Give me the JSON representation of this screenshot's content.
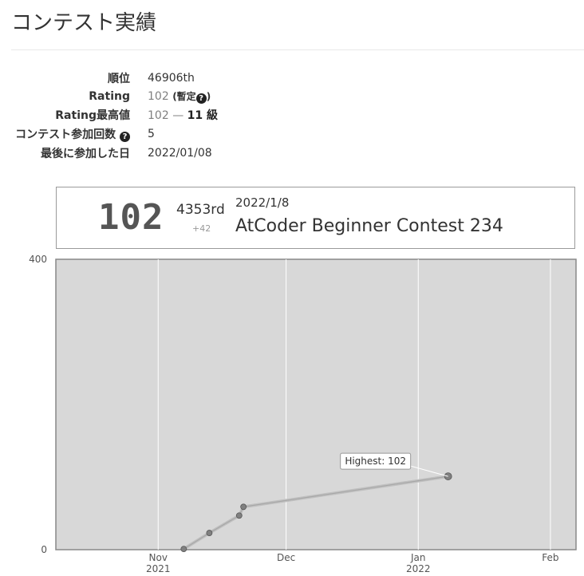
{
  "page": {
    "title": "コンテスト実績"
  },
  "stats": {
    "rank_label": "順位",
    "rank_value": "46906th",
    "rating_label": "Rating",
    "rating_value": "102",
    "rating_note_prefix": "(",
    "rating_note": "暫定",
    "rating_note_suffix": ")",
    "highest_label": "Rating最高値",
    "highest_value": "102",
    "highest_sep": "—",
    "highest_kyu": "11 級",
    "participation_label": "コンテスト参加回数",
    "participation_value": "5",
    "last_label": "最後に参加した日",
    "last_value": "2022/01/08"
  },
  "card": {
    "rating": "102",
    "rank": "4353rd",
    "diff": "+42",
    "date": "2022/1/8",
    "contest": "AtCoder Beginner Contest 234"
  },
  "chart_data": {
    "type": "line",
    "y_ticks": [
      "0",
      "400"
    ],
    "ylim": [
      0,
      400
    ],
    "x_ticks": [
      {
        "label": "Nov",
        "sub": "2021",
        "date": "2021-11-01"
      },
      {
        "label": "Dec",
        "sub": "",
        "date": "2021-12-01"
      },
      {
        "label": "Jan",
        "sub": "2022",
        "date": "2022-01-01"
      },
      {
        "label": "Feb",
        "sub": "",
        "date": "2022-02-01"
      }
    ],
    "xlim": [
      "2021-10-08",
      "2022-02-07"
    ],
    "points": [
      {
        "date": "2021-11-07",
        "rating": 1
      },
      {
        "date": "2021-11-13",
        "rating": 23
      },
      {
        "date": "2021-11-20",
        "rating": 47
      },
      {
        "date": "2021-11-21",
        "rating": 59
      },
      {
        "date": "2022-01-08",
        "rating": 101
      }
    ],
    "highest_label": "Highest: 102",
    "grid": true,
    "colors": {
      "background": "#d8d8d8",
      "line": "#c0c0c0",
      "point": "#808080",
      "grid": "#ffffff",
      "frame": "#888888"
    }
  }
}
